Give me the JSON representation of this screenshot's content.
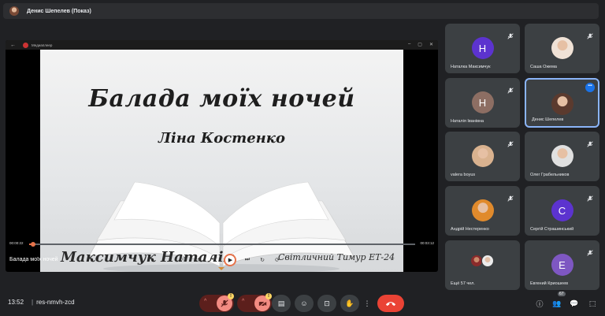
{
  "presenter_bar": {
    "title": "Денис Шепелев (Показ)"
  },
  "media_player": {
    "app_name": "Медиаплеер",
    "time_current": "00:00:22",
    "time_total": "00:03:12",
    "progress": 0.01,
    "video_title": "Балада моїх ночей"
  },
  "slide": {
    "title": "Балада моїх ночей",
    "author": "Ліна Костенко",
    "caption_left": "Максимчук Наталія",
    "caption_right": "Світличний Тимур ЕТ-24"
  },
  "participants": [
    {
      "name": "Наталка Максимчук",
      "initial": "Н",
      "color": "#5c33cf",
      "muted": true
    },
    {
      "name": "Саша Ожема",
      "initial": "",
      "color": "#f0e2d6",
      "muted": true,
      "photo": true
    },
    {
      "name": "Наталія Іванівна",
      "initial": "Н",
      "color": "#8d6e63",
      "muted": true
    },
    {
      "name": "Денис Шепелев",
      "initial": "",
      "color": "#5b3a2e",
      "muted": false,
      "photo": true,
      "active": true
    },
    {
      "name": "valera boyus",
      "initial": "",
      "color": "#d9b28f",
      "muted": true,
      "photo": true
    },
    {
      "name": "Олег Грабельников",
      "initial": "",
      "color": "#e0e0e0",
      "muted": true,
      "photo": true
    },
    {
      "name": "Андрій Нестеренко",
      "initial": "",
      "color": "#e08a2c",
      "muted": true,
      "photo": true
    },
    {
      "name": "Сергій Страшинський",
      "initial": "С",
      "color": "#5c33cf",
      "muted": true
    },
    {
      "name": "Ещё 57 чел.",
      "initial": "",
      "color": "#3c4043",
      "muted": false,
      "more": true
    },
    {
      "name": "Евгений Криошеев",
      "initial": "Е",
      "color": "#7e57c2",
      "muted": true
    }
  ],
  "bottom": {
    "clock": "13:52",
    "separator": "|",
    "meeting_code": "res-nmvh-zcd",
    "participant_count": "67"
  },
  "colors": {
    "accent": "#e6734b",
    "end_call": "#ea4335",
    "active_border": "#8ab4f8"
  }
}
